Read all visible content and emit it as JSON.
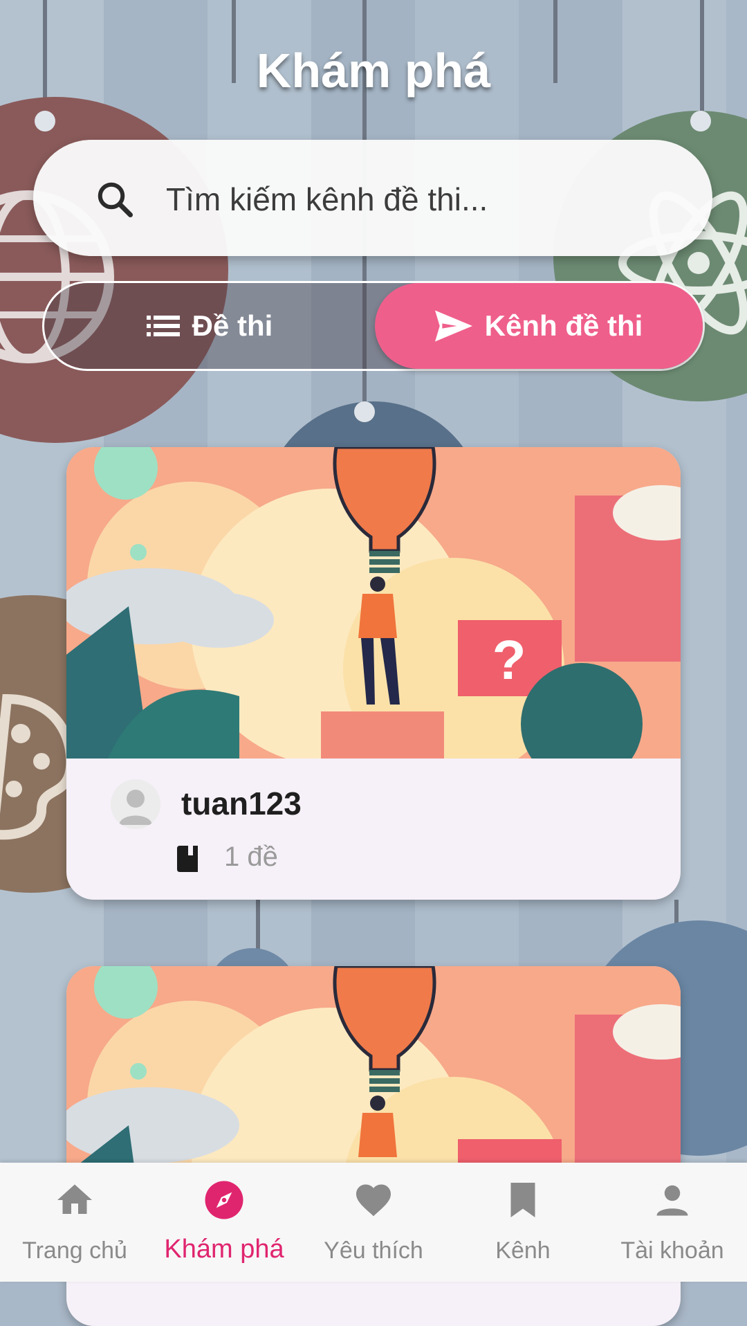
{
  "header": {
    "title": "Khám phá"
  },
  "search": {
    "placeholder": "Tìm kiếm kênh đề thi...",
    "icon": "search-icon"
  },
  "segments": [
    {
      "label": "Đề thi",
      "icon": "list-icon",
      "selected": false
    },
    {
      "label": "Kênh đề thi",
      "icon": "send-icon",
      "selected": true
    }
  ],
  "channels": [
    {
      "username": "tuan123",
      "exam_count": "1 đề",
      "icon": "book-icon"
    }
  ],
  "nav": [
    {
      "label": "Trang chủ",
      "icon": "home-icon"
    },
    {
      "label": "Khám phá",
      "icon": "compass-icon",
      "active": true
    },
    {
      "label": "Yêu thích",
      "icon": "heart-icon"
    },
    {
      "label": "Kênh",
      "icon": "bookmark-icon"
    },
    {
      "label": "Tài khoản",
      "icon": "person-icon"
    }
  ],
  "colors": {
    "accent": "#ef5f8c",
    "nav_active": "#e0256f",
    "nav_inactive": "#8a8a8a",
    "card_bg": "#f6f0f8"
  }
}
